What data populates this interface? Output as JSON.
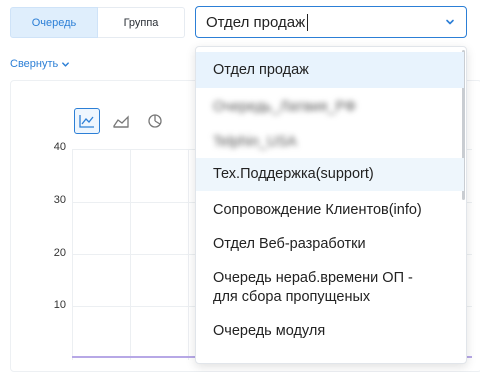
{
  "toggle": {
    "queue_label": "Очередь",
    "group_label": "Группа"
  },
  "queue_select": {
    "value": "Отдел продаж"
  },
  "collapse": {
    "label": "Свернуть"
  },
  "chart_data": {
    "type": "line",
    "y_ticks": [
      "40",
      "30",
      "20",
      "10"
    ],
    "ylim": [
      0,
      40
    ],
    "grid": true,
    "chart_type_icons": [
      "line-chart-icon",
      "area-chart-icon",
      "pie-chart-icon"
    ]
  },
  "dropdown": {
    "items": [
      {
        "label": "Отдел продаж",
        "state": "selected"
      },
      {
        "label": "Очередь_Латвия_РФ",
        "state": "blurred"
      },
      {
        "label": "Telphin_USA",
        "state": "blurred"
      },
      {
        "label": "Тех.Поддержка(support)",
        "state": "hover"
      },
      {
        "label": "Сопровождение Клиентов(info)",
        "state": "normal"
      },
      {
        "label": "Отдел Веб-разработки",
        "state": "normal"
      },
      {
        "label": "Очередь нераб.времени ОП -",
        "label2": "для сбора пропущеных",
        "state": "normal"
      },
      {
        "label": "Очередь модуля",
        "state": "normal"
      }
    ]
  },
  "colors": {
    "accent": "#2c7fd6",
    "selected_bg": "#e8f3fd",
    "baseline": "#b7a8e6"
  }
}
